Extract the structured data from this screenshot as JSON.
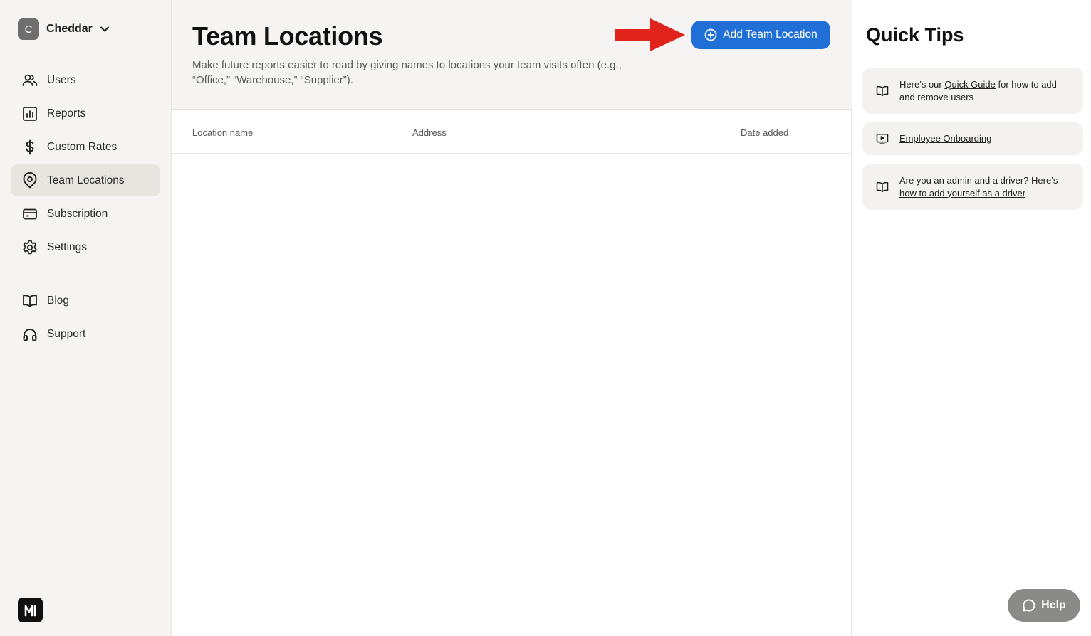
{
  "account": {
    "initial": "C",
    "name": "Cheddar"
  },
  "nav": {
    "primary": [
      {
        "label": "Users",
        "icon": "users-icon"
      },
      {
        "label": "Reports",
        "icon": "reports-icon"
      },
      {
        "label": "Custom Rates",
        "icon": "dollar-icon"
      },
      {
        "label": "Team Locations",
        "icon": "location-pin-icon",
        "active": true
      },
      {
        "label": "Subscription",
        "icon": "credit-card-icon"
      },
      {
        "label": "Settings",
        "icon": "gear-icon"
      }
    ],
    "secondary": [
      {
        "label": "Blog",
        "icon": "book-icon"
      },
      {
        "label": "Support",
        "icon": "headphones-icon"
      }
    ]
  },
  "header": {
    "title": "Team Locations",
    "description": "Make future reports easier to read by giving names to locations your team visits often (e.g., “Office,” “Warehouse,” “Supplier”).",
    "add_button_label": "Add Team Location"
  },
  "table": {
    "columns": [
      "Location name",
      "Address",
      "Date added"
    ],
    "rows": []
  },
  "tips": {
    "title": "Quick Tips",
    "items": [
      {
        "prefix": "Here’s our ",
        "link": "Quick Guide",
        "suffix": " for how to add and remove users",
        "icon": "book-icon"
      },
      {
        "prefix": "",
        "link": "Employee Onboarding",
        "suffix": "",
        "icon": "video-icon"
      },
      {
        "prefix": "Are you an admin and a driver? Here’s ",
        "link": "how to add yourself as a driver",
        "suffix": "",
        "icon": "book-icon"
      }
    ]
  },
  "help": {
    "label": "Help"
  },
  "colors": {
    "accent": "#1f6fd6",
    "arrow": "#e0241b",
    "sidebar_bg": "#f5f4f2",
    "active_item_bg": "#e8e5e1"
  }
}
